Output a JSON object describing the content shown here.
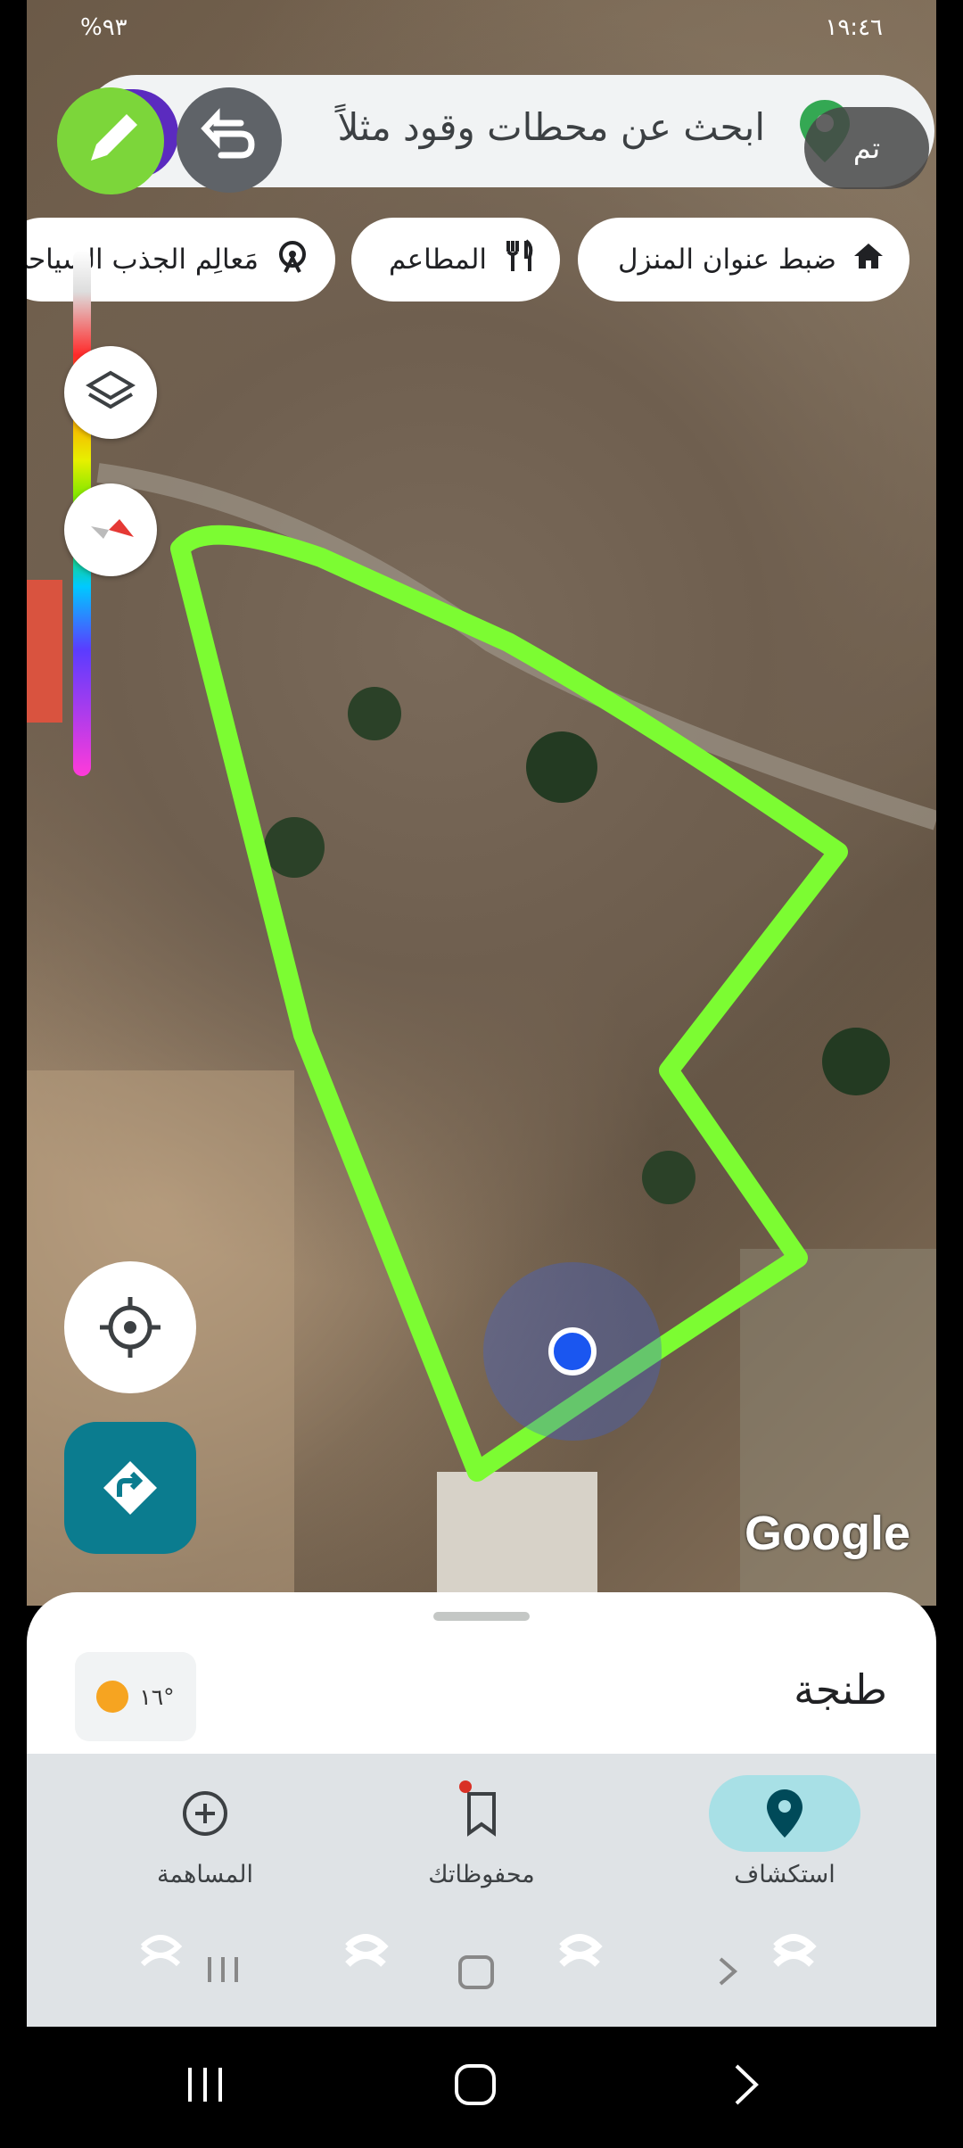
{
  "status": {
    "time": "١٩:٤٦",
    "battery": "%٩٣"
  },
  "search": {
    "placeholder": "ابحث عن محطات وقود مثلاً",
    "done_label": "تم"
  },
  "chips": [
    {
      "label": "ضبط عنوان المنزل",
      "icon": "home-icon"
    },
    {
      "label": "المطاعم",
      "icon": "restaurant-icon"
    },
    {
      "label": "مَعالِم الجذب السياحي",
      "icon": "attraction-icon"
    }
  ],
  "map": {
    "watermark": "Google",
    "highlight_color": "#7CFC32",
    "location_dot_color": "#1a56f0"
  },
  "sheet": {
    "city": "طنجة",
    "temperature": "١٦°"
  },
  "nav": [
    {
      "label": "المساهمة",
      "icon": "add-circle-icon",
      "active": false
    },
    {
      "label": "محفوظاتك",
      "icon": "bookmark-icon",
      "active": false
    },
    {
      "label": "استكشاف",
      "icon": "location-pin-icon",
      "active": true
    }
  ]
}
